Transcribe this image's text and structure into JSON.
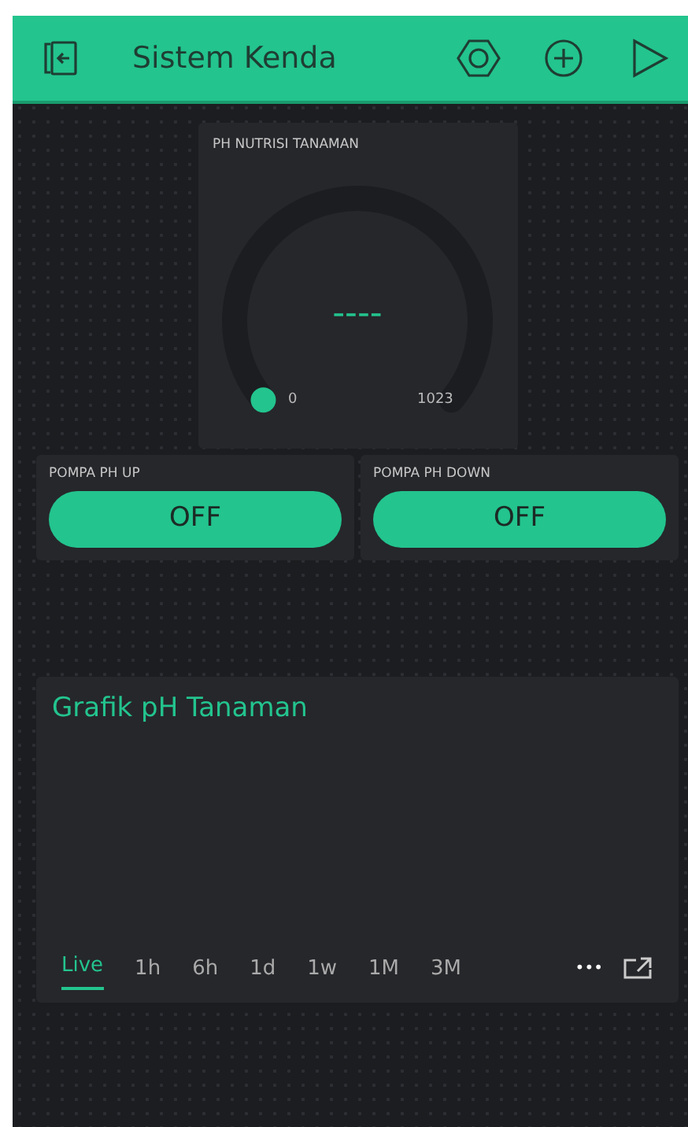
{
  "header": {
    "title": "Sistem Kenda"
  },
  "gauge": {
    "label": "PH NUTRISI TANAMAN",
    "value": "----",
    "min": "0",
    "max": "1023"
  },
  "switches": [
    {
      "label": "POMPA PH UP",
      "button": "OFF",
      "on": false
    },
    {
      "label": "POMPA PH DOWN",
      "button": "OFF",
      "on": false
    }
  ],
  "chart": {
    "title": "Grafik pH Tanaman",
    "ranges": [
      {
        "label": "Live",
        "selected": true
      },
      {
        "label": "1h",
        "selected": false
      },
      {
        "label": "6h",
        "selected": false
      },
      {
        "label": "1d",
        "selected": false
      },
      {
        "label": "1w",
        "selected": false
      },
      {
        "label": "1M",
        "selected": false
      },
      {
        "label": "3M",
        "selected": false
      }
    ],
    "more": "•••"
  }
}
